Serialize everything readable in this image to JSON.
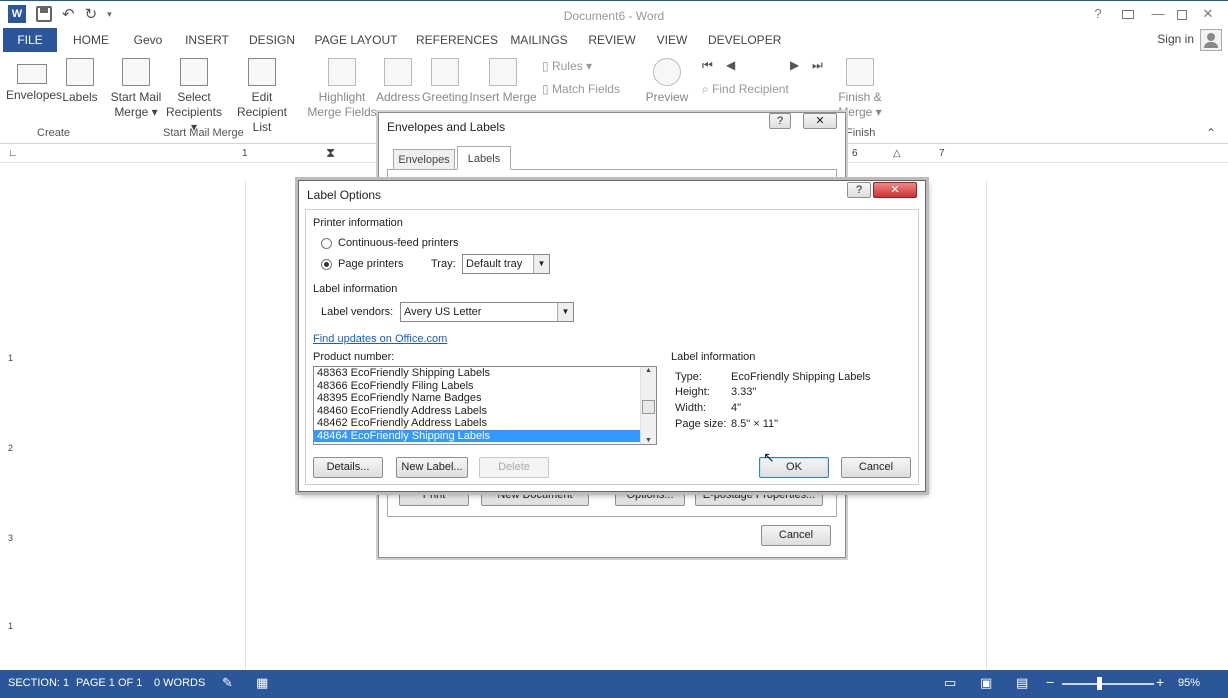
{
  "window": {
    "title": "Document6 - Word",
    "help": "?",
    "signin": "Sign in"
  },
  "tabs": [
    "FILE",
    "HOME",
    "Gevo",
    "INSERT",
    "DESIGN",
    "PAGE LAYOUT",
    "REFERENCES",
    "MAILINGS",
    "REVIEW",
    "VIEW",
    "DEVELOPER"
  ],
  "ribbon": {
    "envelopes": "Envelopes",
    "labels": "Labels",
    "start_mail_merge_1": "Start Mail",
    "start_mail_merge_2": "Merge ▾",
    "select_recipients_1": "Select",
    "select_recipients_2": "Recipients ▾",
    "edit_recipient_1": "Edit",
    "edit_recipient_2": "Recipient List",
    "highlight_1": "Highlight",
    "highlight_2": "Merge Fields",
    "address": "Address",
    "greeting": "Greeting",
    "insert_merge": "Insert Merge",
    "rules": "Rules ▾",
    "match_fields": "Match Fields",
    "preview": "Preview",
    "find_recipient": "Find Recipient",
    "finish_1": "Finish &",
    "finish_2": "Merge ▾",
    "group_create": "Create",
    "group_start_mail_merge": "Start Mail Merge",
    "group_finish": "Finish"
  },
  "ruler": {
    "h": [
      "1",
      "6",
      "7"
    ],
    "v": [
      "1",
      "2",
      "3",
      "1"
    ]
  },
  "env_dialog": {
    "title": "Envelopes and Labels",
    "help": "?",
    "close": "✕",
    "tab_envelopes": "Envelopes",
    "tab_labels": "Labels",
    "print": "Print",
    "new_document": "New Document",
    "options": "Options...",
    "epostage": "E-postage Properties...",
    "cancel": "Cancel"
  },
  "label_options": {
    "title": "Label Options",
    "help": "?",
    "close": "✕",
    "printer_info": "Printer information",
    "continuous": "Continuous-feed printers",
    "page_printers": "Page printers",
    "tray_label": "Tray:",
    "tray_value": "Default tray",
    "label_info_heading": "Label information",
    "vendors_label": "Label vendors:",
    "vendors_value": "Avery US Letter",
    "find_updates": "Find updates on Office.com",
    "product_number": "Product number:",
    "products": [
      "48363 EcoFriendly Shipping Labels",
      "48366 EcoFriendly Filing Labels",
      "48395 EcoFriendly Name Badges",
      "48460 EcoFriendly Address Labels",
      "48462 EcoFriendly Address Labels",
      "48464 EcoFriendly Shipping Labels"
    ],
    "selected_index": 5,
    "info_heading": "Label information",
    "type_label": "Type:",
    "type_value": "EcoFriendly Shipping Labels",
    "height_label": "Height:",
    "height_value": "3.33\"",
    "width_label": "Width:",
    "width_value": "4\"",
    "pagesize_label": "Page size:",
    "pagesize_value": "8.5\" × 11\"",
    "details": "Details...",
    "new_label": "New Label...",
    "delete": "Delete",
    "ok": "OK",
    "cancel": "Cancel"
  },
  "status": {
    "section": "SECTION: 1",
    "page": "PAGE 1 OF 1",
    "words": "0 WORDS",
    "zoom": "95%"
  }
}
